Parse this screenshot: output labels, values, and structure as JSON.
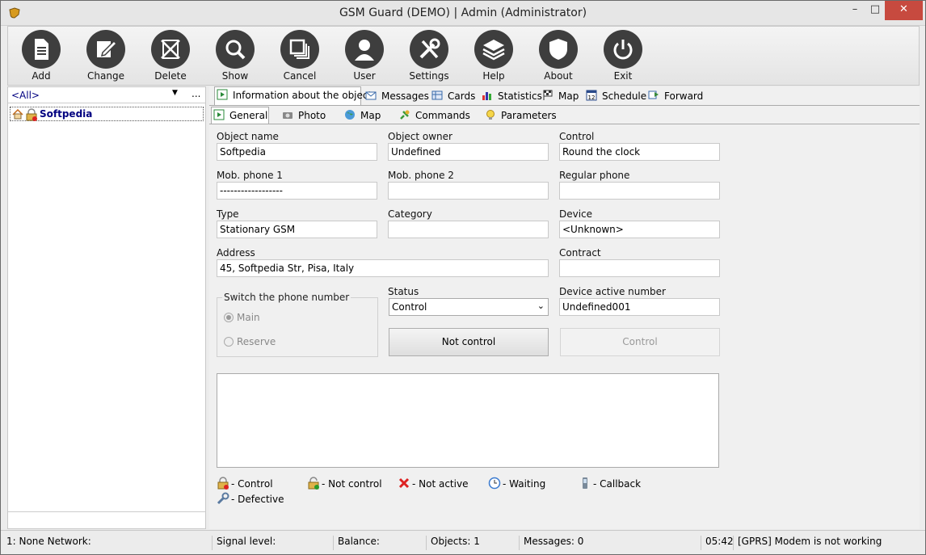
{
  "window": {
    "title": "GSM Guard (DEMO) | Admin (Administrator)",
    "min": "–",
    "max": "□",
    "close": "✕"
  },
  "toolbar": [
    {
      "label": "Add",
      "icon": "document-icon"
    },
    {
      "label": "Change",
      "icon": "edit-icon"
    },
    {
      "label": "Delete",
      "icon": "delete-icon"
    },
    {
      "label": "Show",
      "icon": "magnifier-icon"
    },
    {
      "label": "Cancel",
      "icon": "windows-icon"
    },
    {
      "label": "User",
      "icon": "user-icon"
    },
    {
      "label": "Settings",
      "icon": "tools-icon"
    },
    {
      "label": "Help",
      "icon": "layers-icon"
    },
    {
      "label": "About",
      "icon": "shield-icon"
    },
    {
      "label": "Exit",
      "icon": "power-icon"
    }
  ],
  "left": {
    "filter": "<All>",
    "dots": "...",
    "tree_item": "Softpedia"
  },
  "tabs": [
    {
      "label": "Information about the object",
      "icon": "info-icon"
    },
    {
      "label": "Messages",
      "icon": "envelope-icon"
    },
    {
      "label": "Cards",
      "icon": "cards-icon"
    },
    {
      "label": "Statistics",
      "icon": "chart-icon"
    },
    {
      "label": "Map",
      "icon": "flag-icon"
    },
    {
      "label": "Schedule",
      "icon": "calendar-icon"
    },
    {
      "label": "Forward",
      "icon": "forward-icon"
    }
  ],
  "calendar_num": "12",
  "subtabs": [
    {
      "label": "General",
      "icon": "general-icon"
    },
    {
      "label": "Photo",
      "icon": "camera-icon"
    },
    {
      "label": "Map",
      "icon": "globe-icon"
    },
    {
      "label": "Commands",
      "icon": "commands-icon"
    },
    {
      "label": "Parameters",
      "icon": "bulb-icon"
    }
  ],
  "form": {
    "object_name_label": "Object name",
    "object_name": "Softpedia",
    "object_owner_label": "Object owner",
    "object_owner": "Undefined",
    "control_label": "Control",
    "control": "Round the clock",
    "mob1_label": "Mob. phone 1",
    "mob1": "------------------",
    "mob2_label": "Mob. phone 2",
    "mob2": "",
    "regular_label": "Regular phone",
    "regular": "",
    "type_label": "Type",
    "type": "Stationary GSM",
    "category_label": "Category",
    "category": "",
    "device_label": "Device",
    "device": "<Unknown>",
    "address_label": "Address",
    "address": "45, Softpedia Str, Pisa, Italy",
    "contract_label": "Contract",
    "contract": "",
    "switch_label": "Switch the phone number",
    "main": "Main",
    "reserve": "Reserve",
    "status_label": "Status",
    "status": "Control",
    "device_active_label": "Device active number",
    "device_active": "Undefined001",
    "not_control_btn": "Not control",
    "control_btn": "Control"
  },
  "legend": [
    {
      "label": "- Control",
      "icon": "lock-icon"
    },
    {
      "label": "- Not control",
      "icon": "unlock-icon"
    },
    {
      "label": "- Not active",
      "icon": "x-icon"
    },
    {
      "label": "- Waiting",
      "icon": "clock-icon"
    },
    {
      "label": "- Callback",
      "icon": "phone-icon"
    },
    {
      "label": "- Defective",
      "icon": "wrench-icon"
    }
  ],
  "status": {
    "network": "1: None Network:",
    "signal": "Signal level:",
    "balance": "Balance:",
    "objects": "Objects: 1",
    "messages": "Messages: 0",
    "time": "05:42",
    "modem": "[GPRS] Modem is not working"
  },
  "colors": {
    "accent": "#000080",
    "toolbar_icon_bg": "#3e3e3e",
    "close_btn": "#c74a3f"
  }
}
